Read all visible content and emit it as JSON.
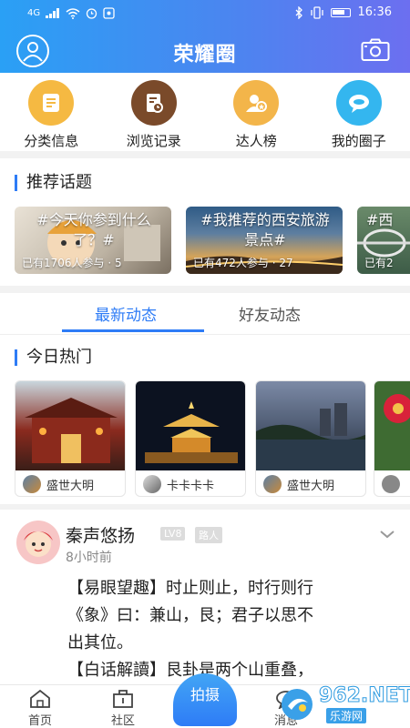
{
  "status": {
    "network": "4G",
    "time": "16:36"
  },
  "header": {
    "title": "荣耀圈"
  },
  "quicknav": [
    {
      "label": "分类信息",
      "icon": "category-info-icon",
      "color": "#f5b942"
    },
    {
      "label": "浏览记录",
      "icon": "browse-history-icon",
      "color": "#7a4a2a"
    },
    {
      "label": "达人榜",
      "icon": "expert-rank-icon",
      "color": "#f3b54a"
    },
    {
      "label": "我的圈子",
      "icon": "my-circle-icon",
      "color": "#34b6ef"
    }
  ],
  "topics": {
    "title": "推荐话题",
    "items": [
      {
        "text": "#今天你参到什么了？#",
        "meta": "已有1706人参与 · 5"
      },
      {
        "text": "#我推荐的西安旅游景点#",
        "meta": "已有472人参与 · 27"
      },
      {
        "text": "#西",
        "meta": "已有2"
      }
    ]
  },
  "tabs": {
    "active": "最新动态",
    "other": "好友动态"
  },
  "hot": {
    "title": "今日热门",
    "items": [
      {
        "user": "盛世大明"
      },
      {
        "user": "卡卡卡卡"
      },
      {
        "user": "盛世大明"
      },
      {
        "user": ""
      }
    ]
  },
  "post": {
    "name": "秦声悠扬",
    "level": "LV8",
    "role": "路人",
    "time": "8小时前",
    "lines": [
      "【易眼望趣】时止则止，时行则行",
      "《象》曰：兼山，艮；君子以思不",
      "出其位。",
      "【白话解讀】艮卦是两个山重叠，"
    ]
  },
  "bottomnav": {
    "home": "首页",
    "community": "社区",
    "shoot": "拍摄",
    "message": "消息"
  },
  "watermark": {
    "main": "962.NET",
    "sub": "乐游网"
  }
}
